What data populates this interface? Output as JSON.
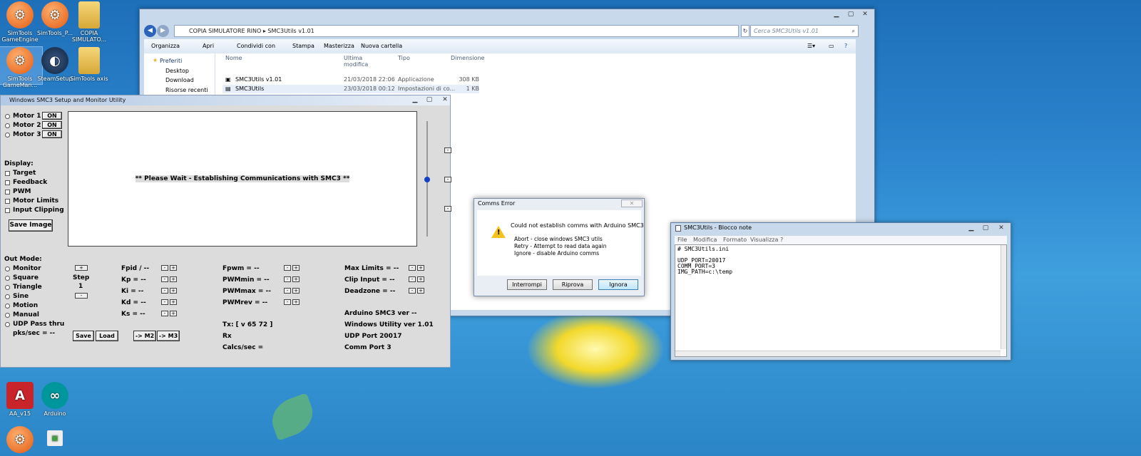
{
  "desktop": {
    "icons": [
      {
        "label": "SimTools GameEngine",
        "icon": "simtools-icon"
      },
      {
        "label": "SimTools_P...",
        "icon": "simtools-plugin-icon"
      },
      {
        "label": "COPIA SIMULATO...",
        "icon": "folder-icon"
      },
      {
        "label": "SimTools GameMan...",
        "icon": "simtools-gamemanager-icon"
      },
      {
        "label": "SteamSetup",
        "icon": "steam-icon"
      },
      {
        "label": "SimTools axis",
        "icon": "folder-icon"
      },
      {
        "label": "AA_v15",
        "icon": "acrobat-icon"
      },
      {
        "label": "Arduino",
        "icon": "arduino-icon"
      }
    ]
  },
  "explorer": {
    "breadcrumb": [
      "COPIA SIMULATORE RINO",
      "SMC3Utils v1.01"
    ],
    "search_placeholder": "Cerca SMC3Utils v1.01",
    "toolbar": [
      "Organizza",
      "Apri",
      "Condividi con",
      "Stampa",
      "Masterizza",
      "Nuova cartella"
    ],
    "nav": [
      "Preferiti",
      "Desktop",
      "Download",
      "Risorse recenti"
    ],
    "columns": [
      "Nome",
      "Ultima modifica",
      "Tipo",
      "Dimensione"
    ],
    "files": [
      {
        "name": "SMC3Utils v1.01",
        "modified": "21/03/2018 22:06",
        "type": "Applicazione",
        "size": "308 KB"
      },
      {
        "name": "SMC3Utils",
        "modified": "23/03/2018 00:12",
        "type": "Impostazioni di co...",
        "size": "1 KB"
      }
    ]
  },
  "smc3": {
    "title": "Windows SMC3 Setup and Monitor Utility",
    "motors": [
      {
        "label": "Motor 1",
        "btn": "ON"
      },
      {
        "label": "Motor 2",
        "btn": "ON"
      },
      {
        "label": "Motor 3",
        "btn": "ON"
      }
    ],
    "display_label": "Display:",
    "display_opts": [
      "Target",
      "Feedback",
      "PWM",
      "Motor Limits",
      "Input Clipping"
    ],
    "save_image": "Save Image",
    "screen_msg": "** Please Wait - Establishing Communications with SMC3 **",
    "out_mode_label": "Out Mode:",
    "out_modes": [
      "Monitor",
      "Square",
      "Triangle",
      "Sine",
      "Motion",
      "Manual",
      "UDP Pass thru"
    ],
    "pks": "pks/sec = --",
    "step_label": "Step",
    "step_value": "1",
    "col1": [
      "Fpid / --",
      "Kp = --",
      "Ki = --",
      "Kd = --",
      "Ks = --"
    ],
    "col2": [
      "Fpwm = --",
      "PWMmin = --",
      "PWMmax = --",
      "PWMrev = --"
    ],
    "col3": [
      "Max Limits = --",
      "Clip Input = --",
      "Deadzone = --"
    ],
    "arduino_ver": "Arduino SMC3 ver --",
    "win_ver": "Windows Utility ver 1.01",
    "udp_port": "UDP Port 20017",
    "comm_port": "Comm Port 3",
    "tx": "Tx: [ v 65 72 ]",
    "rx": "Rx",
    "calcs": "Calcs/sec =",
    "btn_save": "Save",
    "btn_load": "Load",
    "btn_m2": "-> M2",
    "btn_m3": "-> M3"
  },
  "dialog": {
    "title": "Comms Error",
    "message": "Could not establish comms with Arduino SMC3",
    "lines": [
      "Abort - close windows SMC3 utils",
      "Retry - Attempt to read data again",
      "Ignore - disable Arduino comms"
    ],
    "buttons": [
      "Interrompi",
      "Riprova",
      "Ignora"
    ]
  },
  "notepad": {
    "title": "SMC3Utils - Blocco note",
    "menu": [
      "File",
      "Modifica",
      "Formato",
      "Visualizza",
      "?"
    ],
    "content": "# SMC3Utils.ini\n\nUDP_PORT=20017\nCOMM_PORT=3\nIMG_PATH=c:\\temp"
  }
}
